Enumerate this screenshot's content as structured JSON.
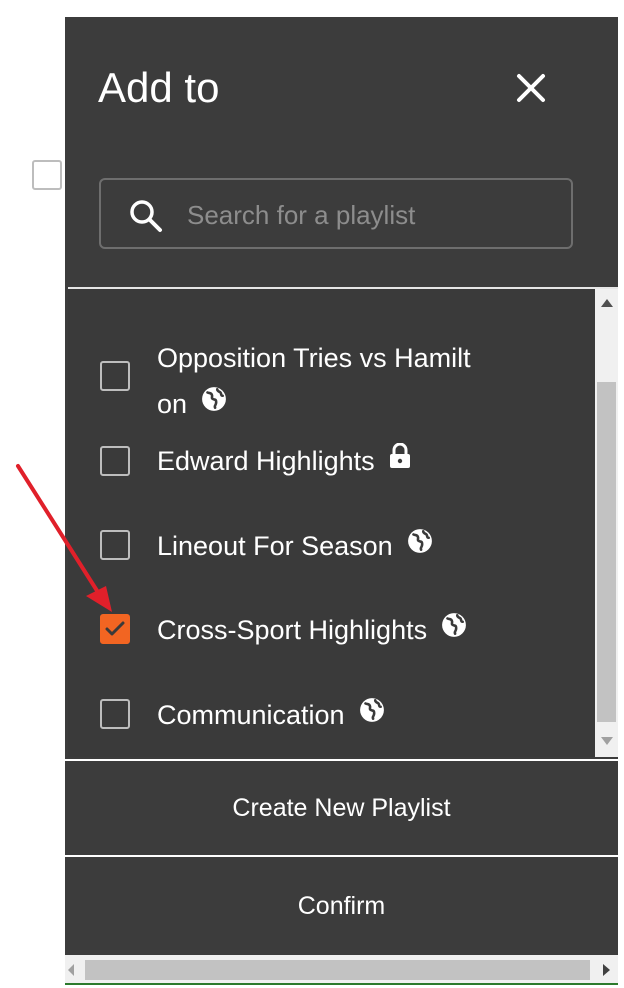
{
  "dialog": {
    "title": "Add to",
    "close_icon": "close-icon",
    "search": {
      "placeholder": "Search for a playlist",
      "value": "",
      "icon": "search-icon"
    }
  },
  "playlists": [
    {
      "name": "Opposition Tries vs Hamilt\non",
      "checked": false,
      "visibility": "public",
      "icon": "globe-icon"
    },
    {
      "name": "Edward Highlights",
      "checked": false,
      "visibility": "private",
      "icon": "lock-icon"
    },
    {
      "name": "Lineout For Season",
      "checked": false,
      "visibility": "public",
      "icon": "globe-icon"
    },
    {
      "name": "Cross-Sport Highlights",
      "checked": true,
      "visibility": "public",
      "icon": "globe-icon"
    },
    {
      "name": "Communication",
      "checked": false,
      "visibility": "public",
      "icon": "globe-icon"
    }
  ],
  "buttons": {
    "create": "Create New Playlist",
    "confirm": "Confirm"
  },
  "colors": {
    "panel": "#3c3c3c",
    "checked": "#f26522",
    "annotation_arrow": "#e0202a"
  }
}
